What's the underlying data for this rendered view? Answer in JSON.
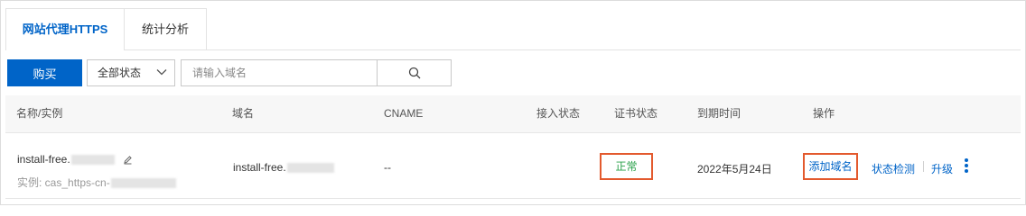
{
  "tabs": [
    {
      "label": "网站代理HTTPS",
      "active": true
    },
    {
      "label": "统计分析",
      "active": false
    }
  ],
  "toolbar": {
    "buy_label": "购买",
    "status_filter": "全部状态",
    "search_placeholder": "请输入域名"
  },
  "table": {
    "headers": [
      "名称/实例",
      "域名",
      "CNAME",
      "接入状态",
      "证书状态",
      "到期时间",
      "操作"
    ],
    "rows": [
      {
        "name": "install-free.",
        "instance": "实例: cas_https-cn-",
        "domain": "install-free.",
        "cname": "--",
        "access_status": "",
        "cert_status": "正常",
        "expiry": "2022年5月24日",
        "actions": [
          "添加域名",
          "状态检测",
          "升级"
        ]
      }
    ]
  },
  "colors": {
    "accent": "#0064c8",
    "status_ok": "#2aa14a",
    "highlight_border": "#e35a2e"
  },
  "icons": {
    "chevron": "chevron-down-icon",
    "search": "search-icon",
    "edit": "pencil-icon",
    "more": "more-vertical-icon"
  }
}
